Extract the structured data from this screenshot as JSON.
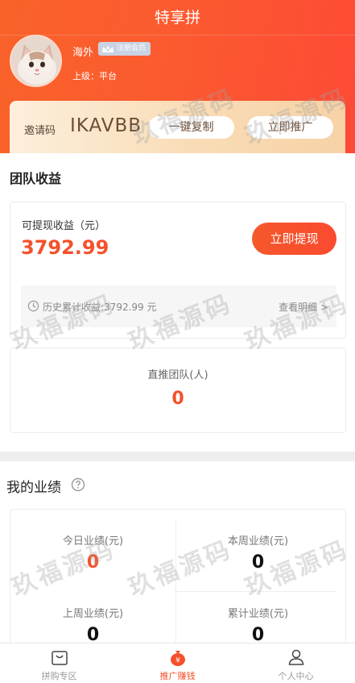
{
  "header": {
    "title": "特享拼"
  },
  "profile": {
    "nickname": "海外",
    "badge": "注册会员",
    "upline": "上级：平台"
  },
  "invite": {
    "label": "邀请码",
    "code": "IKAVBB",
    "copy_label": "一键复制",
    "promote_label": "立即推广"
  },
  "team_earnings": {
    "section_title": "团队收益",
    "withdrawable_label": "可提现收益（元）",
    "withdrawable_amount": "3792.99",
    "withdraw_button": "立即提现",
    "history_text": "历史累计收益:3792.99 元",
    "history_link": "查看明细 >",
    "team_label": "直推团队(人)",
    "team_count": "0"
  },
  "performance": {
    "section_title": "我的业绩",
    "metrics": [
      {
        "label": "今日业绩(元)",
        "value": "0"
      },
      {
        "label": "本周业绩(元)",
        "value": "0"
      },
      {
        "label": "上周业绩(元)",
        "value": "0"
      },
      {
        "label": "累计业绩(元)",
        "value": "0"
      }
    ]
  },
  "watermark": "玖福源码",
  "tabs": [
    {
      "label": "拼购专区",
      "icon": "shopping-bag-icon"
    },
    {
      "label": "推广赚钱",
      "icon": "money-bag-icon"
    },
    {
      "label": "个人中心",
      "icon": "user-icon"
    }
  ],
  "colors": {
    "accent": "#f4512b",
    "header": "#fb5b2f",
    "invite_bg": "#f9dcb6"
  }
}
